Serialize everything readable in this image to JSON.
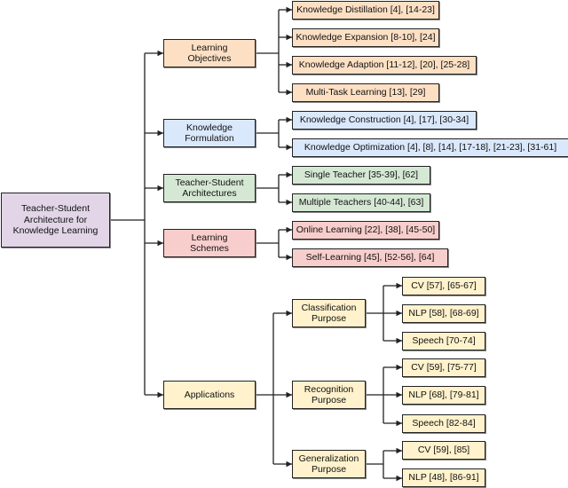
{
  "root": {
    "label": "Teacher-Student Architecture for Knowledge Learning",
    "color": "#e1d5e7"
  },
  "categories": [
    {
      "label": "Learning Objectives",
      "color": "#fde0c4",
      "children": [
        "Knowledge Distillation [4], [14-23]",
        "Knowledge Expansion [8-10], [24]",
        "Knowledge Adaption [11-12], [20], [25-28]",
        "Multi-Task Learning [13], [29]"
      ]
    },
    {
      "label": "Knowledge Formulation",
      "color": "#dae8fc",
      "children": [
        "Knowledge Construction [4], [17], [30-34]",
        "Knowledge Optimization [4], [8], [14], [17-18], [21-23], [31-61]"
      ]
    },
    {
      "label": "Teacher-Student Architectures",
      "color": "#d5e8d4",
      "children": [
        "Single Teacher [35-39], [62]",
        "Multiple Teachers [40-44], [63]"
      ]
    },
    {
      "label": "Learning Schemes",
      "color": "#f8cecc",
      "children": [
        "Online Learning [22], [38], [45-50]",
        "Self-Learning [45], [52-56], [64]"
      ]
    },
    {
      "label": "Applications",
      "color": "#fff2cc",
      "purposes": [
        {
          "label": "Classification Purpose",
          "children": [
            "CV [57], [65-67]",
            "NLP [58], [68-69]",
            "Speech [70-74]"
          ]
        },
        {
          "label": "Recognition Purpose",
          "children": [
            "CV [59], [75-77]",
            "NLP [68], [79-81]",
            "Speech [82-84]"
          ]
        },
        {
          "label": "Generalization Purpose",
          "children": [
            "CV [59], [85]",
            "NLP [48], [86-91]"
          ]
        }
      ]
    }
  ]
}
